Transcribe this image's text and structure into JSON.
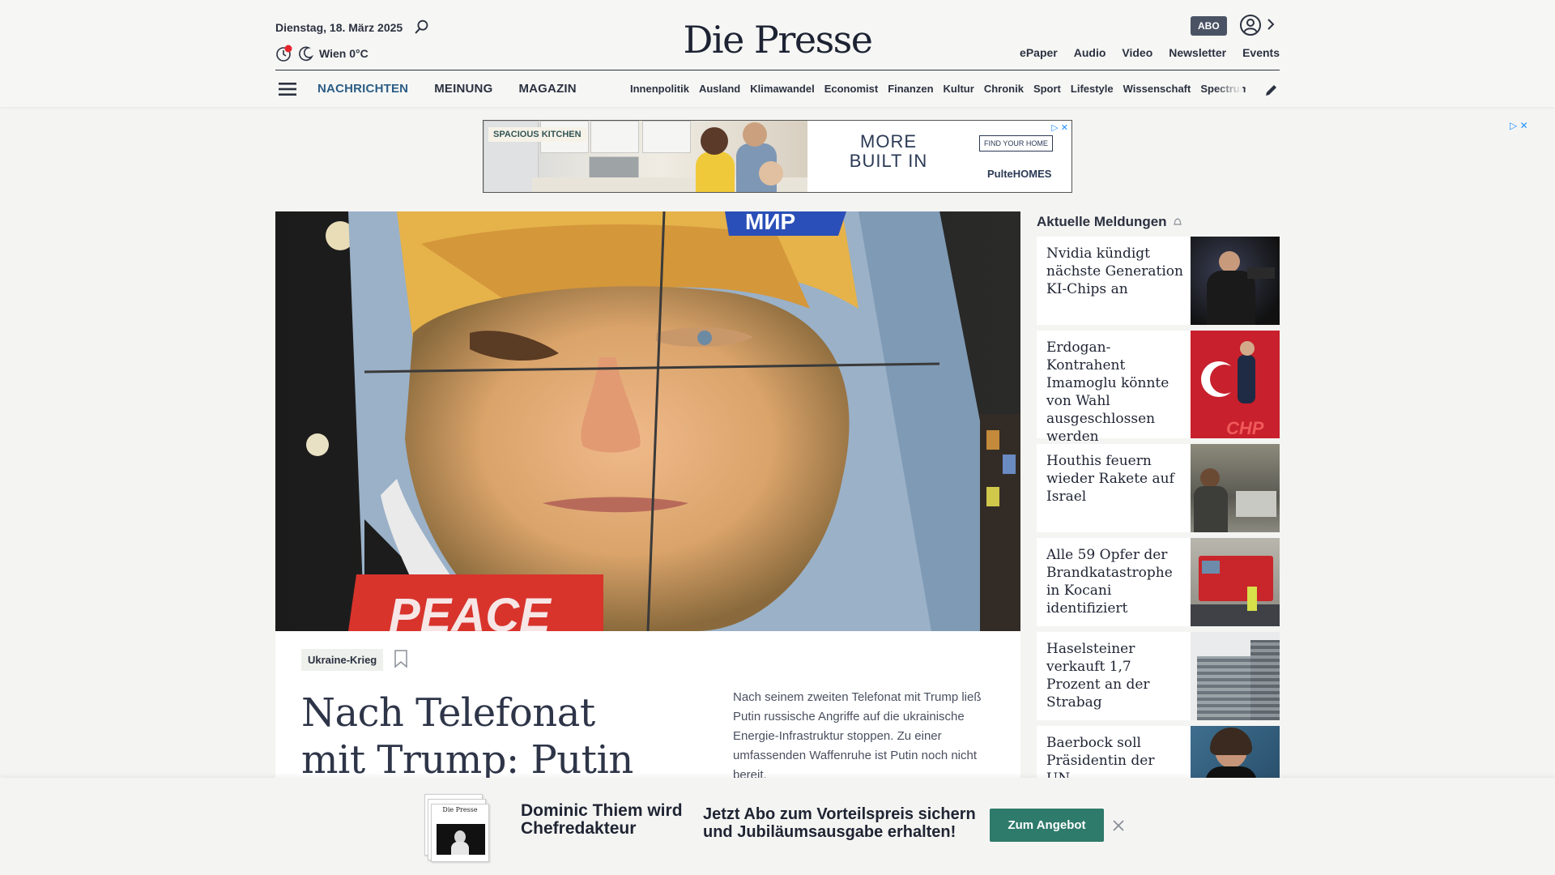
{
  "header": {
    "date": "Dienstag, 18. März 2025",
    "weather": "Wien 0°C",
    "logo": "Die Presse",
    "abo_label": "ABO",
    "top_links": [
      "ePaper",
      "Audio",
      "Video",
      "Newsletter",
      "Events"
    ],
    "main_nav": [
      {
        "label": "NACHRICHTEN",
        "active": true
      },
      {
        "label": "MEINUNG",
        "active": false
      },
      {
        "label": "MAGAZIN",
        "active": false
      }
    ],
    "sub_nav": [
      "Innenpolitik",
      "Ausland",
      "Klimawandel",
      "Economist",
      "Finanzen",
      "Kultur",
      "Chronik",
      "Sport",
      "Lifestyle",
      "Wissenschaft",
      "Spectrum"
    ]
  },
  "ad": {
    "tag": "SPACIOUS KITCHEN",
    "copy_line1": "MORE",
    "copy_line2": "BUILT IN",
    "cta": "FIND YOUR HOME",
    "brand": "PulteHOMES"
  },
  "lead": {
    "image_text_top": "МИР",
    "image_text_bottom": "PEACE",
    "tag": "Ukraine-Krieg",
    "headline": "Nach Telefonat mit Trump: Putin macht",
    "teaser": "Nach seinem zweiten Telefonat mit Trump ließ Putin russische Angriffe auf die ukrainische Energie-Infrastruktur stoppen. Zu einer umfassenden Waffenruhe ist Putin noch nicht bereit."
  },
  "sidebar": {
    "title": "Aktuelle Meldungen",
    "items": [
      {
        "text": "Nvidia kündigt nächste Generation KI-Chips an"
      },
      {
        "text": "Erdogan-Kontrahent Imamoglu könnte von Wahl ausgeschlossen werden",
        "thumb_text": "CHP"
      },
      {
        "text": "Houthis feuern wieder Rakete auf Israel"
      },
      {
        "text": "Alle 59 Opfer der Brandkatastrophe in Kocani identifiziert"
      },
      {
        "text": "Haselsteiner verkauft 1,7 Prozent an der Strabag"
      },
      {
        "text": "Baerbock soll Präsidentin der UN-Vollversammlung werden"
      }
    ]
  },
  "banner": {
    "name": "Dominic Thiem wird Chefredakteur",
    "offer": "Jetzt Abo zum Vorteilspreis sichern und Jubiläumsausgabe erhalten!",
    "button": "Zum Angebot"
  }
}
